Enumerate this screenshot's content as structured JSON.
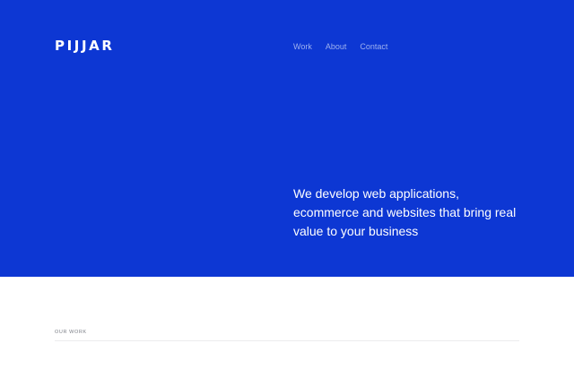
{
  "header": {
    "logo_text": "PIJJAR",
    "nav": [
      {
        "label": "Work"
      },
      {
        "label": "About"
      },
      {
        "label": "Contact"
      }
    ]
  },
  "hero": {
    "tagline": "We develop web applications, ecommerce and websites that bring real value to your business"
  },
  "work_section": {
    "label": "OUR WORK"
  },
  "colors": {
    "hero_background": "#0d37d3",
    "nav_text": "#9db0ef",
    "section_label": "#7d8088",
    "divider": "#ececee"
  }
}
